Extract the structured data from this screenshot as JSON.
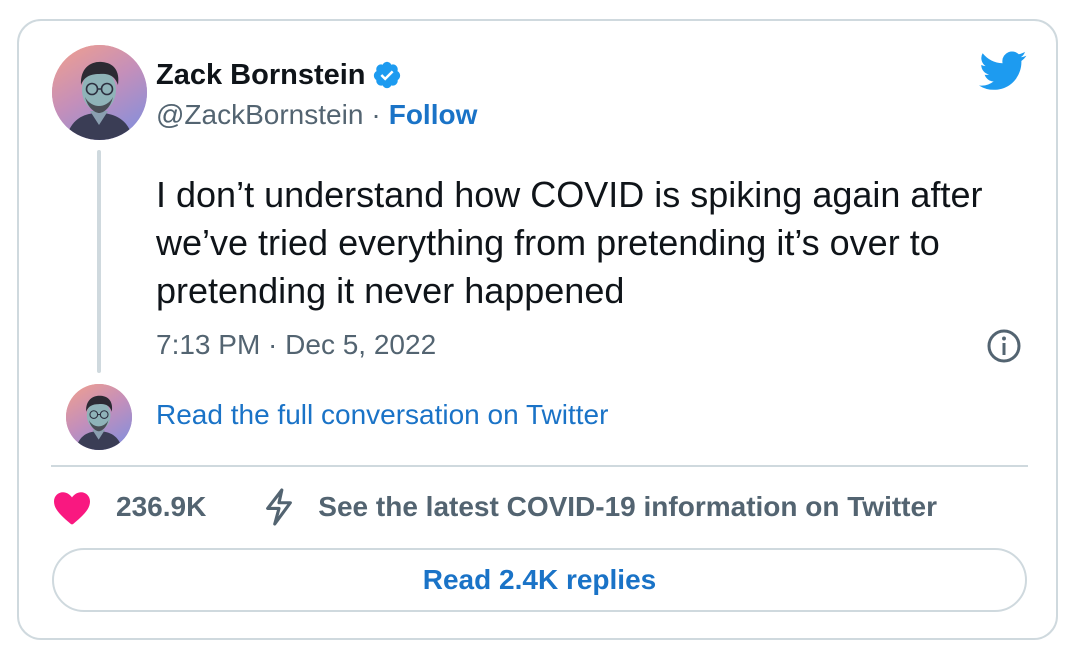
{
  "author": {
    "name": "Zack Bornstein",
    "handle": "@ZackBornstein",
    "separator": "·",
    "follow_label": "Follow",
    "verified": true
  },
  "tweet": {
    "text": "I don’t understand how COVID is spiking again after we’ve tried everything from pretending it’s over to pretending it never happened",
    "timestamp": "7:13 PM · Dec 5, 2022"
  },
  "conversation": {
    "link_label": "Read the full conversation on Twitter"
  },
  "actions": {
    "like_count": "236.9K",
    "covid_info_label": "See the latest COVID-19 information on Twitter"
  },
  "replies_button": {
    "label": "Read 2.4K replies"
  },
  "icons": {
    "brand": "twitter-bird-icon",
    "verified": "verified-badge-icon",
    "info": "info-icon",
    "like": "heart-icon",
    "covid": "lightning-bolt-icon"
  },
  "colors": {
    "accent": "#1a73c7",
    "twitter_blue": "#1d9bf0",
    "heart": "#f91880",
    "secondary_text": "#536471",
    "border": "#cfd9de"
  }
}
